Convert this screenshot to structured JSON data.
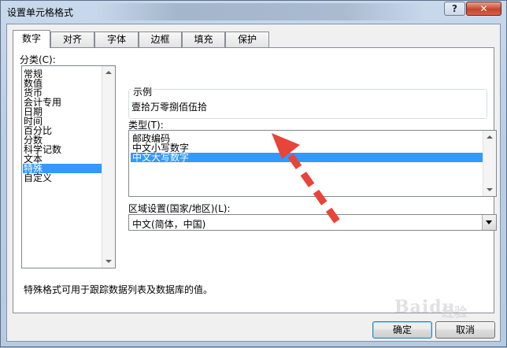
{
  "window": {
    "title": "设置单元格格式",
    "help_label": "?",
    "close_label": "✕"
  },
  "tabs": [
    {
      "label": "数字"
    },
    {
      "label": "对齐"
    },
    {
      "label": "字体"
    },
    {
      "label": "边框"
    },
    {
      "label": "填充"
    },
    {
      "label": "保护"
    }
  ],
  "category": {
    "label": "分类(C):",
    "items": [
      "常规",
      "数值",
      "货币",
      "会计专用",
      "日期",
      "时间",
      "百分比",
      "分数",
      "科学记数",
      "文本",
      "特殊",
      "自定义"
    ],
    "selected": "特殊"
  },
  "sample": {
    "label": "示例",
    "value": "壹拾万零捌佰伍拾"
  },
  "type": {
    "label": "类型(T):",
    "items": [
      "邮政编码",
      "中文小写数字",
      "中文大写数字"
    ],
    "selected": "中文大写数字"
  },
  "locale": {
    "label": "区域设置(国家/地区)(L):",
    "value": "中文(简体，中国)"
  },
  "description": "特殊格式可用于跟踪数据列表及数据库的值。",
  "buttons": {
    "ok": "确定",
    "cancel": "取消"
  },
  "watermark": {
    "text": "Baidu",
    "sub": "经验"
  },
  "colors": {
    "selection": "#3399ff",
    "annotation_arrow": "#e8443a"
  }
}
